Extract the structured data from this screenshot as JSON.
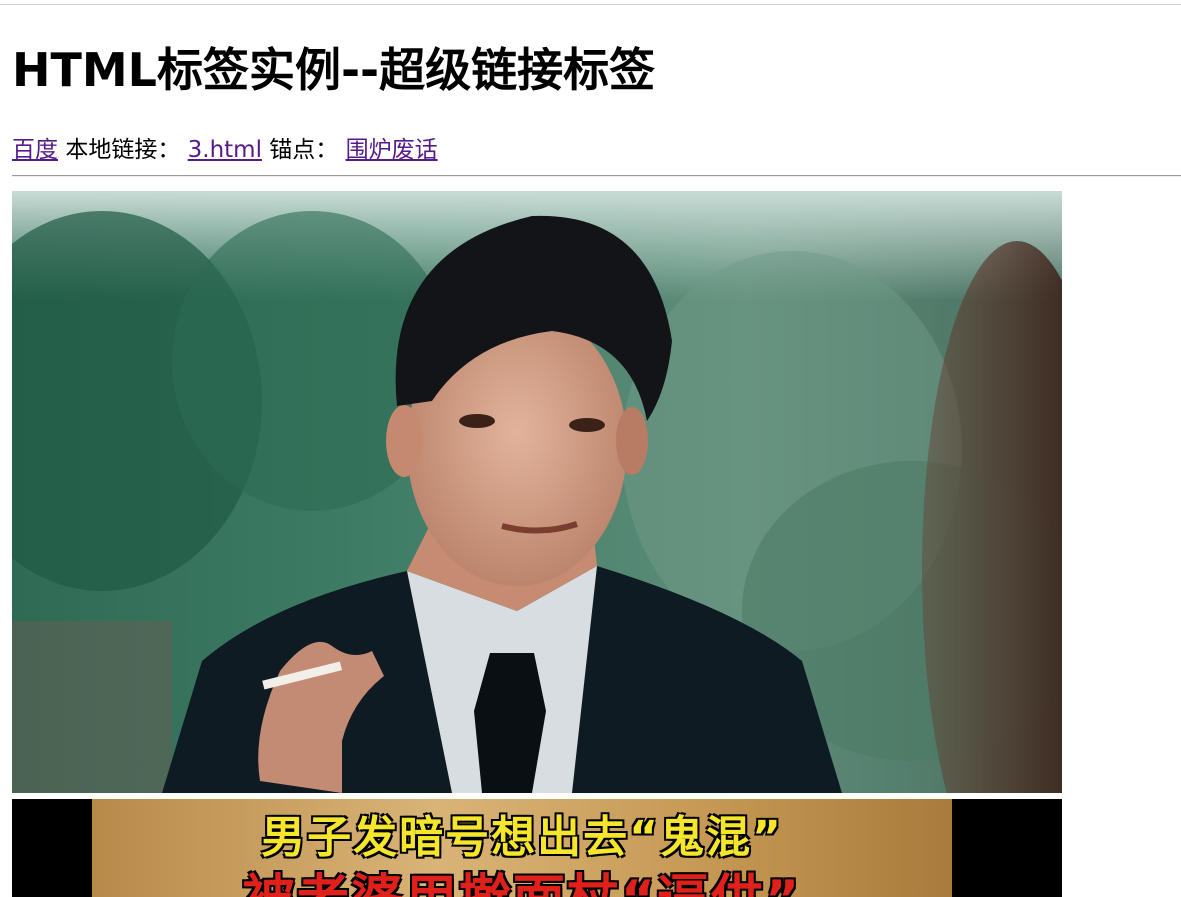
{
  "page": {
    "heading": "HTML标签实例--超级链接标签"
  },
  "links": {
    "baidu": "百度",
    "local_label": "本地链接：",
    "local_link": "3.html",
    "anchor_label": "锚点：",
    "anchor_link": "围炉废话"
  },
  "images": {
    "photo1_alt": "man in suit holding cigarette",
    "photo2_caption_line1": "男子发暗号想出去“鬼混”",
    "photo2_caption_line2": "被老婆用擀面杖“逼供”"
  }
}
